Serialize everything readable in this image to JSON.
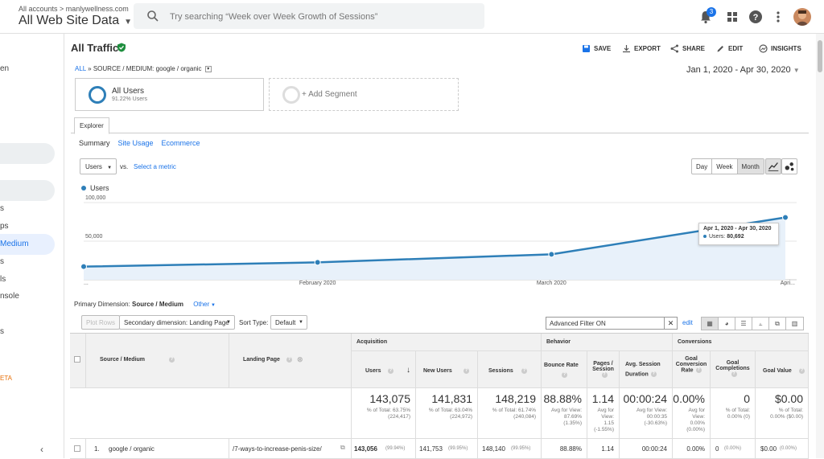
{
  "topbar": {
    "breadcrumb": "All accounts > manlywellness.com",
    "account": "All Web Site Data",
    "search_placeholder": "Try searching “Week over Week Growth of Sessions”",
    "notification_count": "3"
  },
  "sidebar": {
    "items": [
      "en",
      "s",
      "ps",
      "Medium",
      "s",
      "ls",
      "nsole",
      "s",
      "ETA"
    ]
  },
  "header": {
    "title": "All Traffic",
    "actions": [
      "SAVE",
      "EXPORT",
      "SHARE",
      "EDIT",
      "INSIGHTS"
    ]
  },
  "breadcrumb": {
    "all": "ALL",
    "path": "» SOURCE / MEDIUM: google / organic"
  },
  "date_range": "Jan 1, 2020 - Apr 30, 2020",
  "segments": {
    "active_name": "All Users",
    "active_pct": "91.22% Users",
    "add_label": "+ Add Segment"
  },
  "tabs": {
    "explorer": "Explorer"
  },
  "subnav": [
    "Summary",
    "Site Usage",
    "Ecommerce"
  ],
  "metric": {
    "selected": "Users",
    "vs": "vs.",
    "select_metric": "Select a metric"
  },
  "period": [
    "Day",
    "Week",
    "Month"
  ],
  "chart_data": {
    "type": "line",
    "series": [
      {
        "name": "Users",
        "values": [
          17000,
          22500,
          33000,
          80692
        ]
      }
    ],
    "x": [
      "Jan 2020",
      "Feb 2020",
      "Mar 2020",
      "Apr 2020"
    ],
    "x_tick_labels": [
      "...",
      "February 2020",
      "March 2020",
      "Apri..."
    ],
    "y_tick_labels": [
      "100,000",
      "50,000"
    ],
    "ylim": [
      0,
      100000
    ],
    "legend": "top-left",
    "color": "#2e7fb8",
    "tooltip": {
      "title": "Apr 1, 2020 - Apr 30, 2020",
      "label": "Users:",
      "value": "80,692"
    }
  },
  "primary_dimension": {
    "label": "Primary Dimension:",
    "value": "Source / Medium",
    "other": "Other"
  },
  "table_controls": {
    "plot_rows": "Plot Rows",
    "secondary": "Secondary dimension: Landing Page",
    "sort_type_label": "Sort Type:",
    "sort_type": "Default",
    "filter": "Advanced Filter ON",
    "edit": "edit"
  },
  "table": {
    "groups": {
      "acquisition": "Acquisition",
      "behavior": "Behavior",
      "conversions": "Conversions"
    },
    "columns": {
      "source": "Source / Medium",
      "landing": "Landing Page",
      "users": "Users",
      "new_users": "New Users",
      "sessions": "Sessions",
      "bounce": "Bounce Rate",
      "pages_1": "Pages /",
      "pages_2": "Session",
      "dur_1": "Avg. Session",
      "dur_2": "Duration",
      "gcr_1": "Goal",
      "gcr_2": "Conversion",
      "gcr_3": "Rate",
      "gc_1": "Goal",
      "gc_2": "Completions",
      "gv": "Goal Value"
    },
    "totals": {
      "users": "143,075",
      "users_sub1": "% of Total: 63.75%",
      "users_sub2": "(224,417)",
      "new_users": "141,831",
      "new_users_sub1": "% of Total: 63.04%",
      "new_users_sub2": "(224,972)",
      "sessions": "148,219",
      "sessions_sub1": "% of Total: 61.74%",
      "sessions_sub2": "(240,084)",
      "bounce": "88.88%",
      "bounce_sub1": "Avg for View:",
      "bounce_sub2": "87.69%",
      "bounce_sub3": "(1.35%)",
      "pages": "1.14",
      "pages_sub1": "Avg for",
      "pages_sub2": "View:",
      "pages_sub3": "1.15",
      "pages_sub4": "(-1.55%)",
      "dur": "00:00:24",
      "dur_sub1": "Avg for View:",
      "dur_sub2": "00:00:35",
      "dur_sub3": "(-30.63%)",
      "gcr": "0.00%",
      "gcr_sub1": "Avg for",
      "gcr_sub2": "View:",
      "gcr_sub3": "0.00%",
      "gcr_sub4": "(0.00%)",
      "gc": "0",
      "gc_sub1": "% of Total:",
      "gc_sub2": "0.00% (0)",
      "gv": "$0.00",
      "gv_sub1": "% of Total:",
      "gv_sub2": "0.00% ($0.00)"
    },
    "row1": {
      "index": "1.",
      "source": "google / organic",
      "landing": "/7-ways-to-increase-penis-size/",
      "users": "143,056",
      "users_pct": "(99.94%)",
      "new_users": "141,753",
      "new_users_pct": "(99.95%)",
      "sessions": "148,140",
      "sessions_pct": "(99.95%)",
      "bounce": "88.88%",
      "pages": "1.14",
      "dur": "00:00:24",
      "gcr": "0.00%",
      "gc": "0",
      "gc_pct": "(0.00%)",
      "gv": "$0.00",
      "gv_pct": "(0.00%)"
    }
  }
}
